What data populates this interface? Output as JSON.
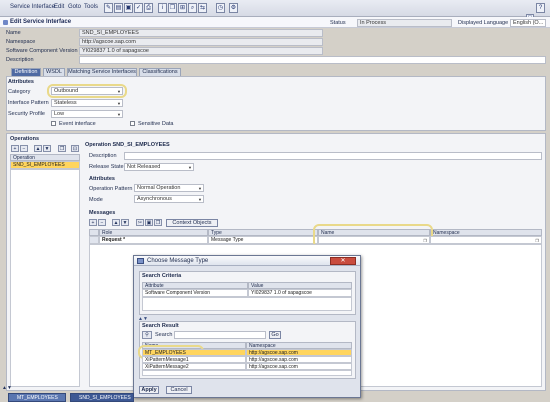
{
  "menubar": {
    "items": [
      "Service Interface",
      "Edit",
      "Goto",
      "Tools"
    ],
    "help_label": "?"
  },
  "title": "Edit Service Interface",
  "header": {
    "name_label": "Name",
    "name_value": "SND_SI_EMPLOYEES",
    "namespace_label": "Namespace",
    "namespace_value": "http://agscoe.sap.com",
    "swc_label": "Software Component Version",
    "swc_value": "YI029837 1.0 of sapagscoe",
    "description_label": "Description",
    "description_value": "",
    "status_label": "Status",
    "status_value": "In Process",
    "language_label": "Displayed Language",
    "language_value": "English (O..."
  },
  "tabs": [
    "Definition",
    "WSDL",
    "Matching Service Interfaces",
    "Classifications"
  ],
  "attributes": {
    "section_title": "Attributes",
    "category_label": "Category",
    "category_value": "Outbound",
    "pattern_label": "Interface Pattern",
    "pattern_value": "Stateless",
    "security_label": "Security Profile",
    "security_value": "Low",
    "event_label": "Event interface",
    "sensitive_label": "Sensitive Data"
  },
  "operations": {
    "section_title": "Operations",
    "column_header": "Operation",
    "items": [
      "SND_SI_EMPLOYEES"
    ],
    "detail_title": "Operation SND_SI_EMPLOYEES",
    "description_label": "Description",
    "description_value": "",
    "release_label": "Release State",
    "release_value": "Not Released",
    "attr_title": "Attributes",
    "op_pattern_label": "Operation Pattern",
    "op_pattern_value": "Normal Operation",
    "mode_label": "Mode",
    "mode_value": "Asynchronous"
  },
  "messages": {
    "section_title": "Messages",
    "context_button": "Context Objects",
    "columns": [
      "Role",
      "Type",
      "Name",
      "Namespace"
    ],
    "rows": [
      {
        "role": "Request *",
        "type": "Message Type",
        "name": "",
        "namespace": ""
      }
    ]
  },
  "dialog": {
    "title": "Choose Message Type",
    "close_label": "Close",
    "criteria_title": "Search Criteria",
    "criteria_columns": [
      "Attribute",
      "Value"
    ],
    "criteria_rows": [
      {
        "attribute": "Software Component Version",
        "value": "YI029837 1.0 of sapagscoe"
      }
    ],
    "result_title": "Search Result",
    "search_label": "Search",
    "search_value": "",
    "go_label": "Go",
    "result_columns": [
      "Name",
      "Namespace"
    ],
    "result_rows": [
      {
        "name": "MT_EMPLOYEES",
        "namespace": "http://agscoe.sap.com",
        "selected": true
      },
      {
        "name": "XiPatternMessage1",
        "namespace": "http://agscoe.sap.com",
        "selected": false
      },
      {
        "name": "XiPatternMessage2",
        "namespace": "http://agscoe.sap.com",
        "selected": false
      }
    ],
    "apply_label": "Apply",
    "cancel_label": "Cancel"
  },
  "bottom_tabs": [
    "MT_EMPLOYEES",
    "SND_SI_EMPLOYEES"
  ],
  "colors": {
    "accent": "#4f6aa3",
    "selection": "#ffd55e",
    "highlight": "#e9d98a",
    "close": "#c94c3e"
  }
}
